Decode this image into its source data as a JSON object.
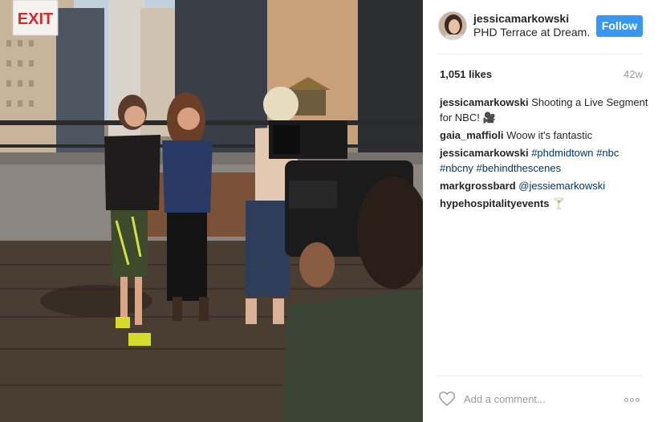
{
  "post": {
    "photo_alt": "",
    "exit_sign": "EXIT"
  },
  "header": {
    "username": "jessicamarkowski",
    "location": "PHD Terrace at Dream..",
    "follow_label": "Follow"
  },
  "stats": {
    "likes": "1,051 likes",
    "age": "42w"
  },
  "comments": [
    {
      "author": "jessicamarkowski",
      "text": "Shooting a Live Segment for NBC! 🎥",
      "tags": []
    },
    {
      "author": "gaia_maffioli",
      "text": "Woow it's fantastic",
      "tags": []
    },
    {
      "author": "jessicamarkowski",
      "text": "",
      "tags": [
        "#phdmidtown",
        "#nbc",
        "#nbcny",
        "#behindthescenes"
      ]
    },
    {
      "author": "markgrossbard",
      "text": "",
      "tags": [
        "@jessiemarkowski"
      ]
    },
    {
      "author": "hypehospitalityevents",
      "text": "🍸",
      "tags": []
    }
  ],
  "add_comment": {
    "placeholder": "Add a comment..."
  },
  "colors": {
    "follow_button": "#3897f0",
    "hashtag": "#003569",
    "muted_text": "#999999"
  },
  "icons": {
    "like": "heart-icon",
    "options": "more-options-icon"
  }
}
